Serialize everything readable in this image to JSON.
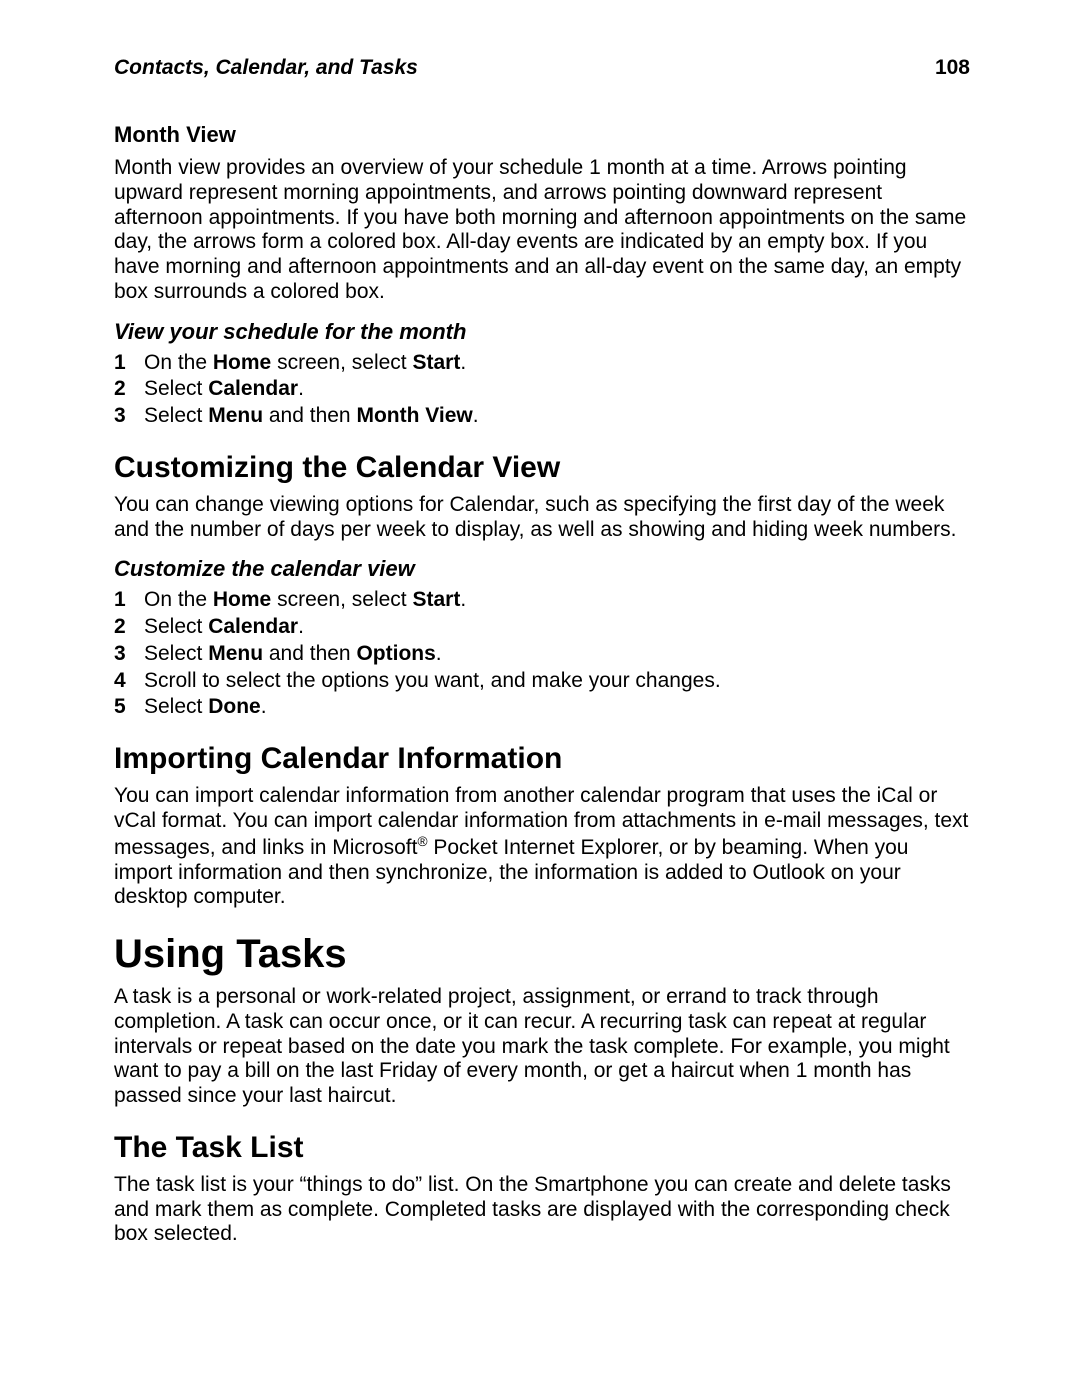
{
  "header": {
    "running_title": "Contacts, Calendar, and Tasks",
    "page_number": "108"
  },
  "s_month_view": {
    "heading": "Month View",
    "body": "Month view provides an overview of your schedule 1 month at a time. Arrows pointing upward represent morning appointments, and arrows pointing downward represent afternoon appointments. If you have both morning and afternoon appointments on the same day, the arrows form a colored box. All-day events are indicated by an empty box. If you have morning and afternoon appointments and an all-day event on the same day, an empty box surrounds a colored box.",
    "proc_title": "View your schedule for the month",
    "steps": [
      {
        "n": "1",
        "pre": "On the ",
        "b1": "Home",
        "mid": " screen, select ",
        "b2": "Start",
        "post": "."
      },
      {
        "n": "2",
        "pre": "Select ",
        "b1": "Calendar",
        "mid": "",
        "b2": "",
        "post": "."
      },
      {
        "n": "3",
        "pre": "Select ",
        "b1": "Menu",
        "mid": " and then ",
        "b2": "Month View",
        "post": "."
      }
    ]
  },
  "s_customize": {
    "heading": "Customizing the Calendar View",
    "body": "You can change viewing options for Calendar, such as specifying the first day of the week and the number of days per week to display, as well as showing and hiding week numbers.",
    "proc_title": "Customize the calendar view",
    "steps": [
      {
        "n": "1",
        "pre": "On the ",
        "b1": "Home",
        "mid": " screen, select ",
        "b2": "Start",
        "post": "."
      },
      {
        "n": "2",
        "pre": "Select ",
        "b1": "Calendar",
        "mid": "",
        "b2": "",
        "post": "."
      },
      {
        "n": "3",
        "pre": "Select ",
        "b1": "Menu",
        "mid": " and then ",
        "b2": "Options",
        "post": "."
      },
      {
        "n": "4",
        "pre": "Scroll to select the options you want, and make your changes.",
        "b1": "",
        "mid": "",
        "b2": "",
        "post": ""
      },
      {
        "n": "5",
        "pre": "Select ",
        "b1": "Done",
        "mid": "",
        "b2": "",
        "post": "."
      }
    ]
  },
  "s_import": {
    "heading": "Importing Calendar Information",
    "body_pre": "You can import calendar information from another calendar program that uses the iCal or vCal format. You can import calendar information from attachments in e-mail messages, text messages, and links in Microsoft",
    "reg": "®",
    "body_post": " Pocket Internet Explorer, or by beaming. When you import information and then synchronize, the information is added to Outlook on your desktop computer."
  },
  "s_tasks": {
    "heading": "Using Tasks",
    "body": "A task is a personal or work-related project, assignment, or errand to track through completion. A task can occur once, or it can recur. A recurring task can repeat at regular intervals or repeat based on the date you mark the task complete. For example, you might want to pay a bill on the last Friday of every month, or get a haircut when 1 month has passed since your last haircut."
  },
  "s_task_list": {
    "heading": "The Task List",
    "body": "The task list is your “things to do” list. On the Smartphone you can create and delete tasks and mark them as complete. Completed tasks are displayed with the corresponding check box selected."
  }
}
